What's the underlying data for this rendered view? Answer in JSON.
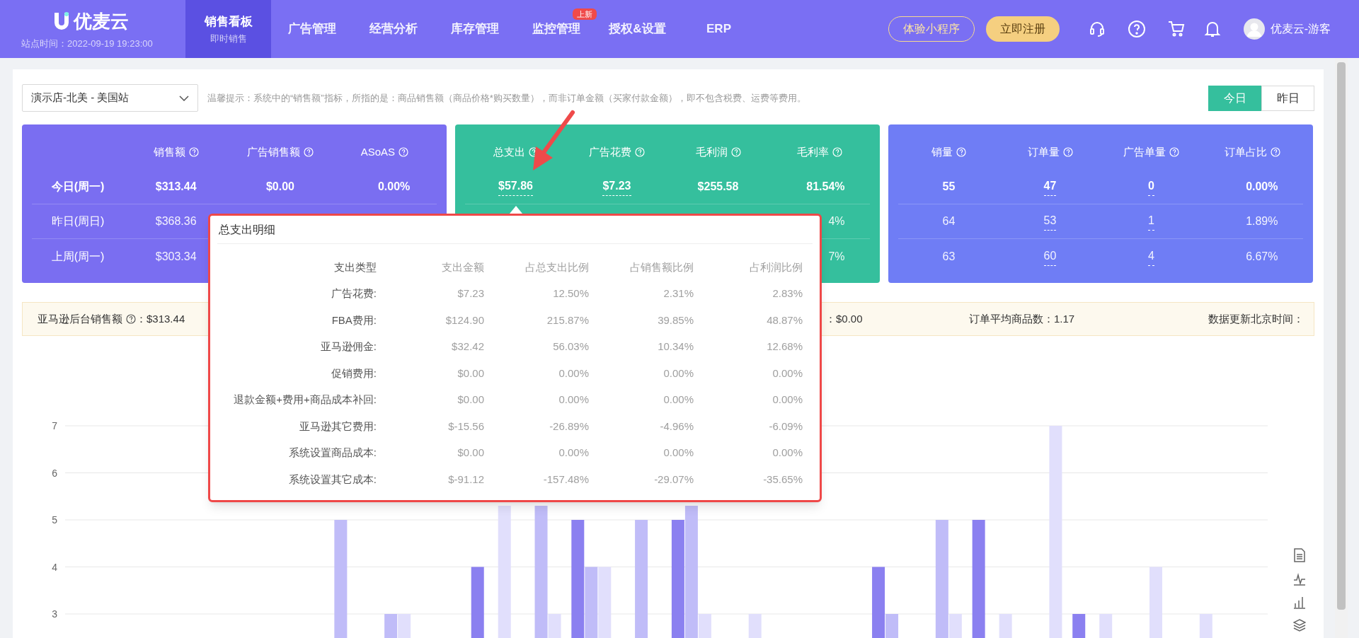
{
  "header": {
    "logo_text": "优麦云",
    "site_time": "站点时间：2022-09-19 19:23:00",
    "nav": [
      {
        "label": "销售看板",
        "sub": "即时销售",
        "selected": true
      },
      {
        "label": "广告管理",
        "selected": false
      },
      {
        "label": "经营分析",
        "selected": false
      },
      {
        "label": "库存管理",
        "selected": false
      },
      {
        "label": "监控管理",
        "badge": "上新",
        "selected": false
      },
      {
        "label": "授权&设置",
        "selected": false
      },
      {
        "label": "ERP",
        "selected": false
      }
    ],
    "mini_program_button": "体验小程序",
    "register_button": "立即注册",
    "user_name": "优麦云-游客"
  },
  "store_select": {
    "value": "演示店-北美 - 美国站"
  },
  "hint": "温馨提示：系统中的“销售额”指标，所指的是：商品销售额（商品价格*购买数量），而非订单金额（买家付款金额），即不包含税费、运费等费用。",
  "day_toggle": [
    {
      "label": "今日",
      "selected": true
    },
    {
      "label": "昨日",
      "selected": false
    }
  ],
  "cards": [
    {
      "color": "#7a6ef1",
      "row_labels": [
        "今日(周一)",
        "昨日(周日)",
        "上周(周一)"
      ],
      "columns": [
        "销售额",
        "广告销售额",
        "ASoAS"
      ],
      "rows": [
        [
          "$313.44",
          "$0.00",
          "0.00%"
        ],
        [
          "$368.36",
          null,
          null
        ],
        [
          "$303.34",
          null,
          null
        ]
      ]
    },
    {
      "color": "#35bf9d",
      "columns": [
        "总支出",
        "广告花费",
        "毛利润",
        "毛利率"
      ],
      "rows": [
        [
          {
            "text": "$57.86",
            "dashed": true
          },
          {
            "text": "$7.23",
            "dashed": true
          },
          "$255.58",
          "81.54%"
        ],
        [
          null,
          null,
          null,
          "4%"
        ],
        [
          null,
          null,
          null,
          "7%"
        ]
      ]
    },
    {
      "color": "#6f7df5",
      "columns": [
        "销量",
        "订单量",
        "广告单量",
        "订单占比"
      ],
      "rows": [
        [
          "55",
          {
            "text": "47",
            "dashed": true
          },
          {
            "text": "0",
            "dashed": true
          },
          "0.00%"
        ],
        [
          "64",
          {
            "text": "53",
            "dashed": true
          },
          {
            "text": "1",
            "dashed": true
          },
          "1.89%"
        ],
        [
          "63",
          {
            "text": "60",
            "dashed": true
          },
          {
            "text": "4",
            "dashed": true
          },
          "6.67%"
        ]
      ]
    }
  ],
  "info_bar": [
    {
      "label": "亚马逊后台销售额",
      "help": true,
      "value": "：$313.44"
    },
    {
      "value": "：$0.00"
    },
    {
      "label": "订单平均商品数：",
      "value": "1.17"
    },
    {
      "label": "数据更新北京时间："
    }
  ],
  "tooltip": {
    "title": "总支出明细",
    "columns": [
      "支出类型",
      "支出金额",
      "占总支出比例",
      "占销售额比例",
      "占利润比例"
    ],
    "rows": [
      [
        "广告花费:",
        "$7.23",
        "12.50%",
        "2.31%",
        "2.83%"
      ],
      [
        "FBA费用:",
        "$124.90",
        "215.87%",
        "39.85%",
        "48.87%"
      ],
      [
        "亚马逊佣金:",
        "$32.42",
        "56.03%",
        "10.34%",
        "12.68%"
      ],
      [
        "促销费用:",
        "$0.00",
        "0.00%",
        "0.00%",
        "0.00%"
      ],
      [
        "退款金额+费用+商品成本补回:",
        "$0.00",
        "0.00%",
        "0.00%",
        "0.00%"
      ],
      [
        "亚马逊其它费用:",
        "$-15.56",
        "-26.89%",
        "-4.96%",
        "-6.09%"
      ],
      [
        "系统设置商品成本:",
        "$0.00",
        "0.00%",
        "0.00%",
        "0.00%"
      ],
      [
        "系统设置其它成本:",
        "$-91.12",
        "-157.48%",
        "-29.07%",
        "-35.65%"
      ]
    ]
  },
  "chart_data": {
    "type": "bar",
    "ylim": [
      0,
      7
    ],
    "yticks": [
      3,
      4,
      5,
      6,
      7
    ],
    "grid": true,
    "series": [
      {
        "color": "#8b80f0",
        "values": [
          null,
          null,
          null,
          null,
          null,
          null,
          null,
          null,
          4,
          null,
          5,
          null,
          5,
          null,
          null,
          null,
          4,
          null,
          5,
          null,
          3,
          null,
          null,
          null
        ]
      },
      {
        "color": "#c0bcf8",
        "values": [
          null,
          null,
          null,
          null,
          null,
          5,
          3,
          null,
          null,
          5.3,
          4,
          5,
          5.3,
          null,
          null,
          null,
          3,
          5,
          null,
          null,
          null,
          null,
          null,
          null
        ]
      },
      {
        "color": "#e1dffc",
        "values": [
          null,
          null,
          null,
          null,
          null,
          null,
          3,
          null,
          5.3,
          3,
          4,
          null,
          3,
          3,
          null,
          null,
          null,
          3,
          3,
          7,
          3,
          4,
          3,
          null
        ]
      }
    ]
  }
}
